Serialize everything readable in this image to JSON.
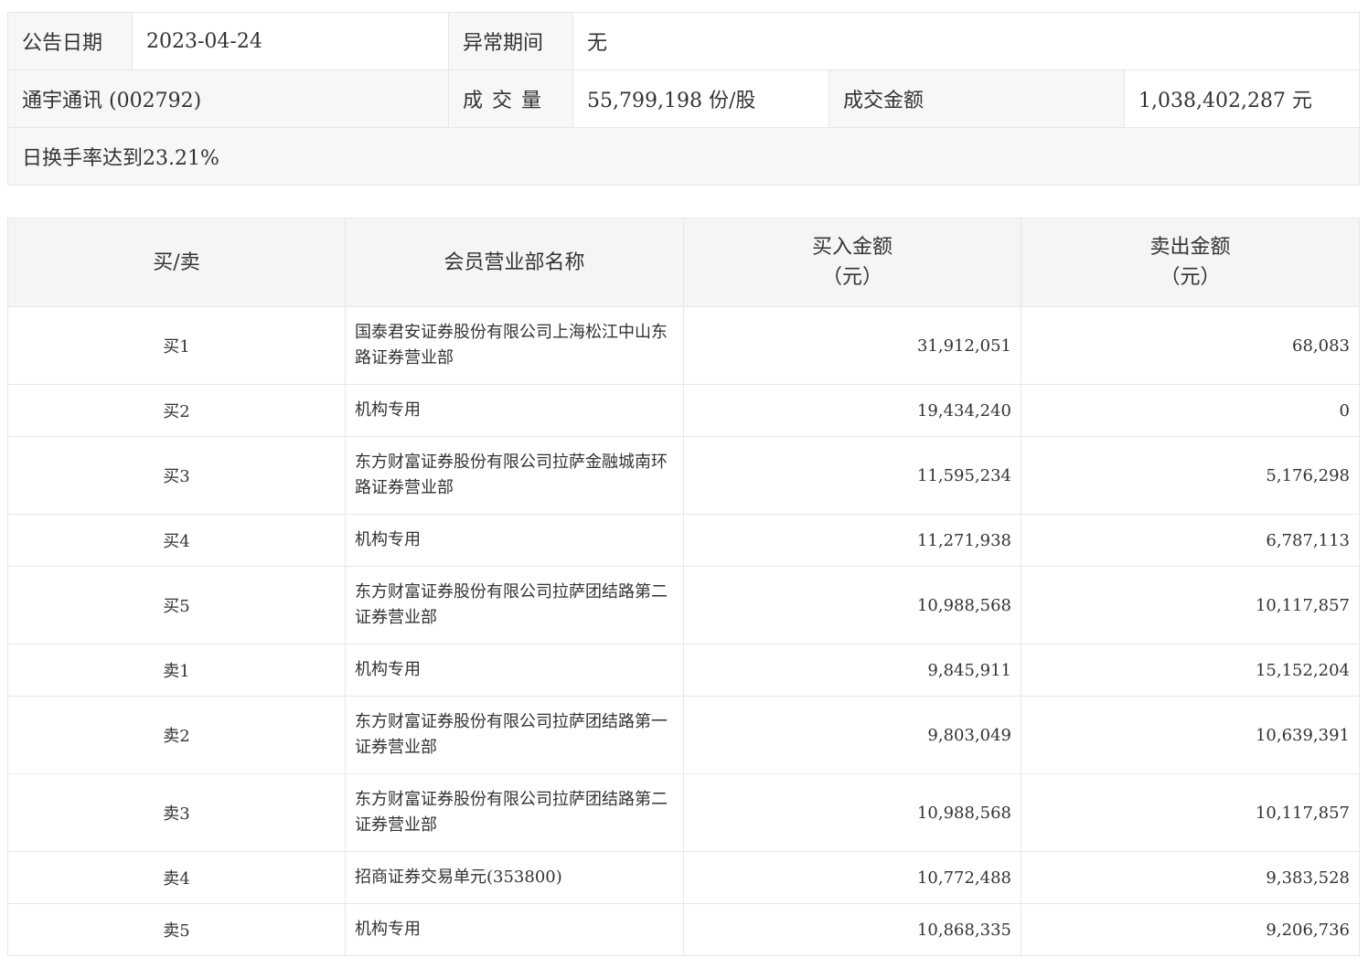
{
  "info": {
    "date_label": "公告日期",
    "date_value": "2023-04-24",
    "abnormal_label": "异常期间",
    "abnormal_value": "无",
    "stock_label": "通宇通讯",
    "stock_code": "(002792)",
    "volume_label": "成交量",
    "volume_value": "55,799,198 份/股",
    "amount_label": "成交金额",
    "amount_value": "1,038,402,287 元",
    "note": "日换手率达到23.21%"
  },
  "table": {
    "headers": {
      "side": "买/卖",
      "dept": "会员营业部名称",
      "buy_line1": "买入金额",
      "buy_line2": "（元）",
      "sell_line1": "卖出金额",
      "sell_line2": "（元）"
    },
    "rows": [
      {
        "side": "买1",
        "dept": "国泰君安证券股份有限公司上海松江中山东路证券营业部",
        "buy": "31,912,051",
        "sell": "68,083"
      },
      {
        "side": "买2",
        "dept": "机构专用",
        "buy": "19,434,240",
        "sell": "0"
      },
      {
        "side": "买3",
        "dept": "东方财富证券股份有限公司拉萨金融城南环路证券营业部",
        "buy": "11,595,234",
        "sell": "5,176,298"
      },
      {
        "side": "买4",
        "dept": "机构专用",
        "buy": "11,271,938",
        "sell": "6,787,113"
      },
      {
        "side": "买5",
        "dept": "东方财富证券股份有限公司拉萨团结路第二证券营业部",
        "buy": "10,988,568",
        "sell": "10,117,857"
      },
      {
        "side": "卖1",
        "dept": "机构专用",
        "buy": "9,845,911",
        "sell": "15,152,204"
      },
      {
        "side": "卖2",
        "dept": "东方财富证券股份有限公司拉萨团结路第一证券营业部",
        "buy": "9,803,049",
        "sell": "10,639,391"
      },
      {
        "side": "卖3",
        "dept": "东方财富证券股份有限公司拉萨团结路第二证券营业部",
        "buy": "10,988,568",
        "sell": "10,117,857"
      },
      {
        "side": "卖4",
        "dept": "招商证券交易单元(353800)",
        "buy": "10,772,488",
        "sell": "9,383,528"
      },
      {
        "side": "卖5",
        "dept": "机构专用",
        "buy": "10,868,335",
        "sell": "9,206,736"
      }
    ]
  }
}
